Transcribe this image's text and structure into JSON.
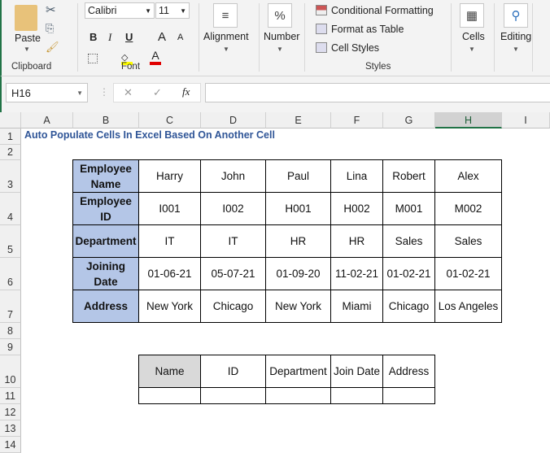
{
  "ribbon": {
    "clipboard": {
      "paste": "Paste",
      "label": "Clipboard"
    },
    "font": {
      "name": "Calibri",
      "size": "11",
      "bold": "B",
      "italic": "I",
      "underline": "U",
      "grow": "A",
      "shrink": "A",
      "color": "A",
      "label": "Font"
    },
    "alignment": {
      "label": "Alignment"
    },
    "number": {
      "label": "Number",
      "icon": "%"
    },
    "styles": {
      "conditional": "Conditional Formatting",
      "format_table": "Format as Table",
      "cell_styles": "Cell Styles",
      "label": "Styles"
    },
    "cells": {
      "label": "Cells"
    },
    "editing": {
      "label": "Editing"
    }
  },
  "formula_bar": {
    "name_box": "H16",
    "cancel": "✕",
    "enter": "✓",
    "fx": "fx",
    "value": ""
  },
  "columns": [
    "A",
    "B",
    "C",
    "D",
    "E",
    "F",
    "G",
    "H",
    "I"
  ],
  "rows": [
    "1",
    "2",
    "3",
    "4",
    "5",
    "6",
    "7",
    "8",
    "9",
    "10",
    "11",
    "12",
    "13",
    "14"
  ],
  "title": "Auto Populate Cells In Excel Based On Another Cell",
  "table1": {
    "headers": [
      "Employee Name",
      "Employee ID",
      "Department",
      "Joining Date",
      "Address"
    ],
    "rows": [
      [
        "Harry",
        "John",
        "Paul",
        "Lina",
        "Robert",
        "Alex"
      ],
      [
        "I001",
        "I002",
        "H001",
        "H002",
        "M001",
        "M002"
      ],
      [
        "IT",
        "IT",
        "HR",
        "HR",
        "Sales",
        "Sales"
      ],
      [
        "01-06-21",
        "05-07-21",
        "01-09-20",
        "11-02-21",
        "01-02-21",
        "01-02-21"
      ],
      [
        "New York",
        "Chicago",
        "New York",
        "Miami",
        "Chicago",
        "Los Angeles"
      ]
    ]
  },
  "table2": {
    "headers": [
      "Name",
      "ID",
      "Department",
      "Join Date",
      "Address"
    ]
  },
  "colors": {
    "accent": "#217346",
    "title": "#2f5597",
    "header_fill": "#b4c6e7"
  }
}
